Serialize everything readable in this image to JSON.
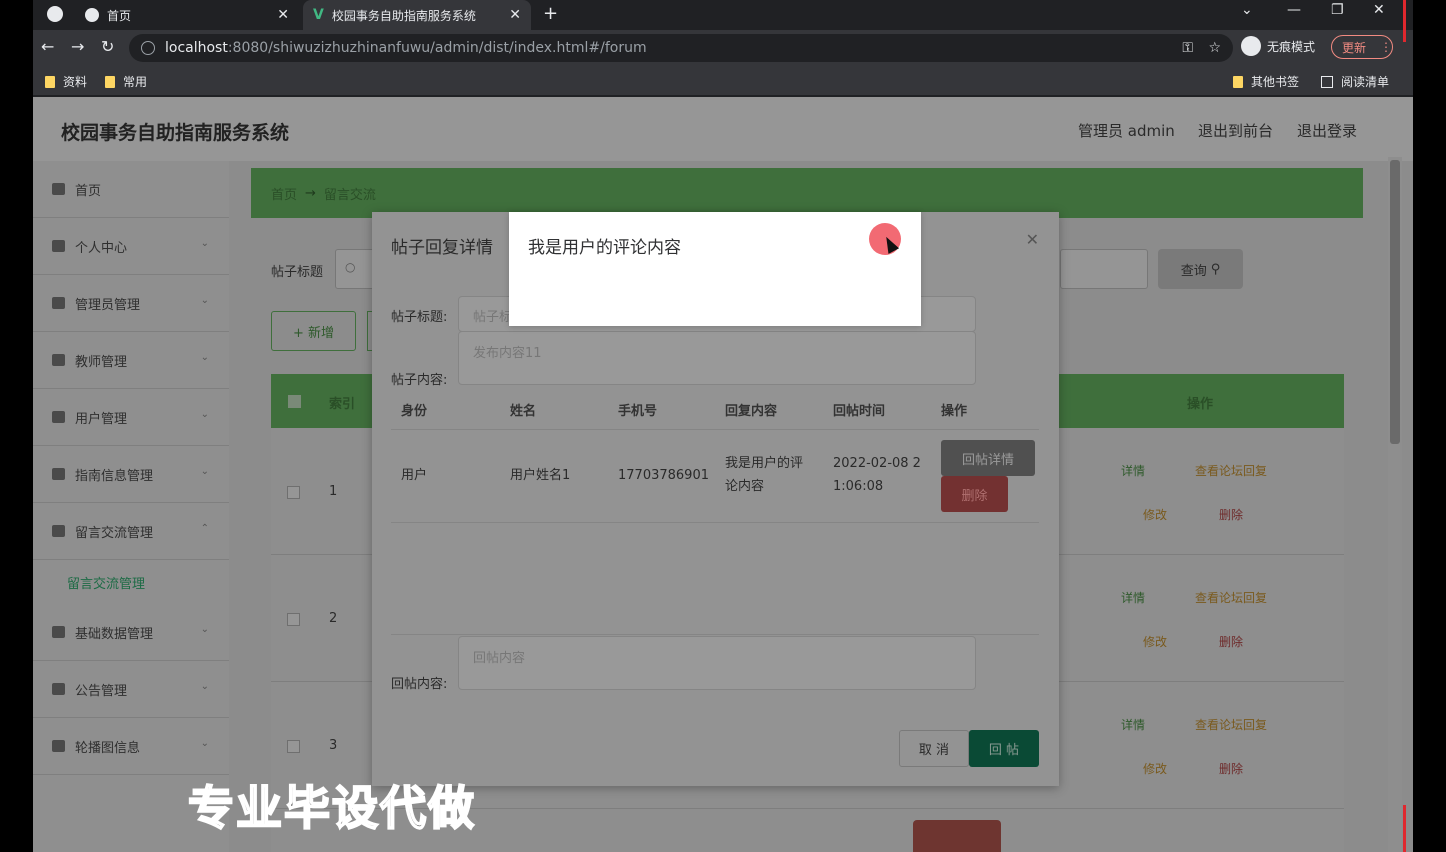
{
  "browser": {
    "tabs": [
      {
        "label": "首页"
      },
      {
        "label": "校园事务自助指南服务系统"
      }
    ],
    "url_host": "localhost",
    "url_path": ":8080/shiwuzizhuzhinanfuwu/admin/dist/index.html#/forum",
    "incognito_label": "无痕模式",
    "update_label": "更新",
    "bookmarks": [
      {
        "label": "资料"
      },
      {
        "label": "常用"
      },
      {
        "label": "其他书签"
      },
      {
        "label": "阅读清单"
      }
    ]
  },
  "app": {
    "title": "校园事务自助指南服务系统",
    "header_links": {
      "user": "管理员 admin",
      "front": "退出到前台",
      "logout": "退出登录"
    }
  },
  "sidebar": {
    "items": [
      {
        "label": "首页"
      },
      {
        "label": "个人中心"
      },
      {
        "label": "管理员管理"
      },
      {
        "label": "教师管理"
      },
      {
        "label": "用户管理"
      },
      {
        "label": "指南信息管理"
      },
      {
        "label": "留言交流管理"
      },
      {
        "label": "基础数据管理"
      },
      {
        "label": "公告管理"
      },
      {
        "label": "轮播图信息"
      }
    ],
    "submenu": "留言交流管理"
  },
  "breadcrumb": {
    "home": "首页",
    "arrow": "→",
    "current": "留言交流"
  },
  "filters": {
    "title_label": "帖子标题",
    "query_label": "查询",
    "add_label": "+ 新增"
  },
  "table": {
    "headers": {
      "index": "索引",
      "ops": "操作"
    },
    "rows": [
      {
        "index": "1"
      },
      {
        "index": "2"
      },
      {
        "index": "3"
      }
    ],
    "actions": {
      "detail": "详情",
      "view_replies": "查看论坛回复",
      "edit": "修改",
      "delete": "删除"
    }
  },
  "dialog": {
    "title": "帖子回复详情",
    "post_title_label": "帖子标题:",
    "post_title_value": "帖子标",
    "post_content_label": "帖子内容:",
    "post_content_value": "发布内容11",
    "reply_table": {
      "headers": [
        "身份",
        "姓名",
        "手机号",
        "回复内容",
        "回帖时间",
        "操作"
      ],
      "row": {
        "identity": "用户",
        "name": "用户姓名1",
        "phone": "17703786901",
        "content_l1": "我是用户的评",
        "content_l2": "论内容",
        "time_l1": "2022-02-08 2",
        "time_l2": "1:06:08",
        "detail_btn": "回帖详情",
        "delete_btn": "删除"
      }
    },
    "reply_label": "回帖内容:",
    "reply_placeholder": "回帖内容",
    "cancel_label": "取 消",
    "submit_label": "回 帖"
  },
  "popup": {
    "text": "我是用户的评论内容"
  },
  "watermark": "专业毕设代做"
}
